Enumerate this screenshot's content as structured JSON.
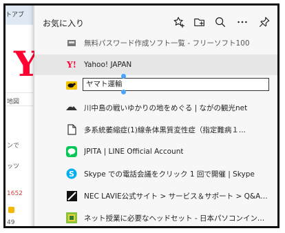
{
  "background": {
    "tab_fragment": "トアブ",
    "side_texts": [
      "地図",
      "ンで",
      "ッツ",
      "1652",
      "49"
    ]
  },
  "panel": {
    "title": "お気に入り",
    "toolbar": [
      "add-favorite",
      "add-folder",
      "search",
      "more",
      "pin"
    ],
    "items": [
      {
        "label": "無料パスワード作成ソフト一覧 - フリーソフト100",
        "icon": "page-gray-icon"
      },
      {
        "label": "Yahoo! JAPAN",
        "icon": "yahoo-icon",
        "highlight": true
      },
      {
        "label": "",
        "icon": "yamato-icon",
        "editing": true,
        "edit_value": "ヤマト運輸"
      },
      {
        "label": "川中島の戦いゆかりの地をめぐる | ながの観光net",
        "icon": "mountain-icon"
      },
      {
        "label": "多系統萎縮症(1)線条体黒質変性症（指定難病１...",
        "icon": "document-icon"
      },
      {
        "label": "JPITA | LINE Official Account",
        "icon": "line-icon"
      },
      {
        "label": "Skype での電話会議をクリック 1 回で開催 | Skype",
        "icon": "skype-icon"
      },
      {
        "label": "NEC LAVIE公式サイト > サービス＆サポート > Q&A ...",
        "icon": "nec-icon"
      },
      {
        "label": "ネット授業に必要なヘッドセット - 日本パソコンインスト...",
        "icon": "headset-site-icon"
      }
    ]
  },
  "colors": {
    "yahoo_red": "#ff0033",
    "line_green": "#06c755",
    "skype_blue": "#00aff0",
    "highlight": "#e6e6e6"
  }
}
